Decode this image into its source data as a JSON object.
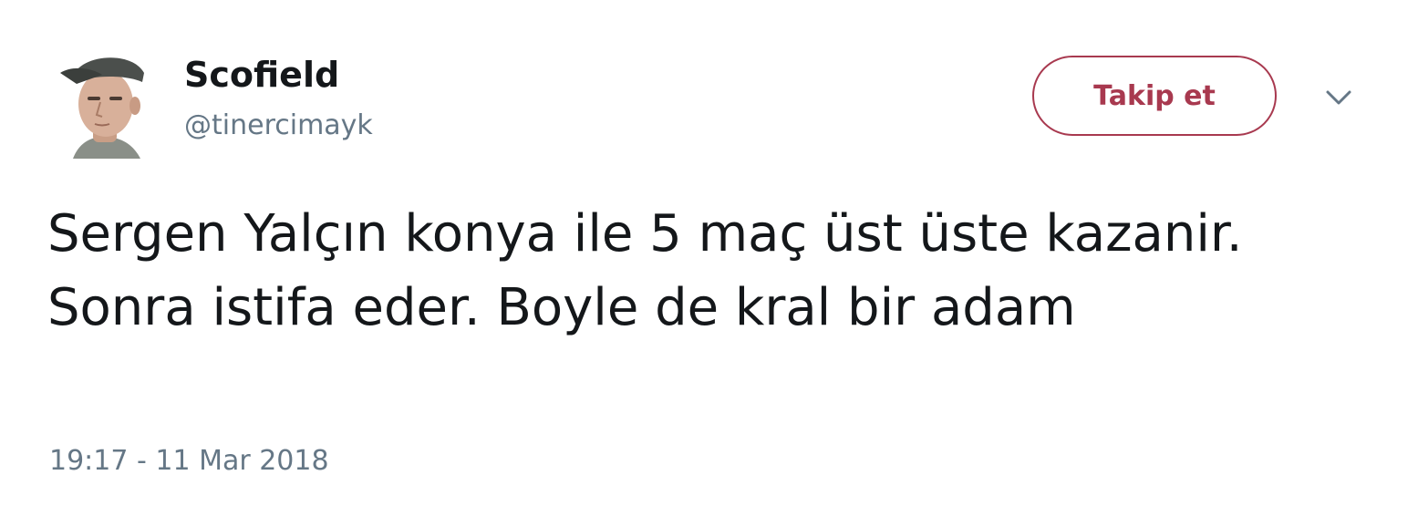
{
  "user": {
    "display_name": "Scofield",
    "handle": "@tinercimayk",
    "avatar_icon": "profile-photo"
  },
  "actions": {
    "follow_label": "Takip et",
    "menu_icon": "chevron-down-icon"
  },
  "tweet": {
    "text": "Sergen Yalçın konya ile 5 maç üst üste kazanir. Sonra istifa eder. Boyle de kral bir adam",
    "timestamp": "19:17 - 11 Mar 2018"
  },
  "colors": {
    "accent": "#a8394f",
    "text": "#14171a",
    "muted": "#657786"
  }
}
